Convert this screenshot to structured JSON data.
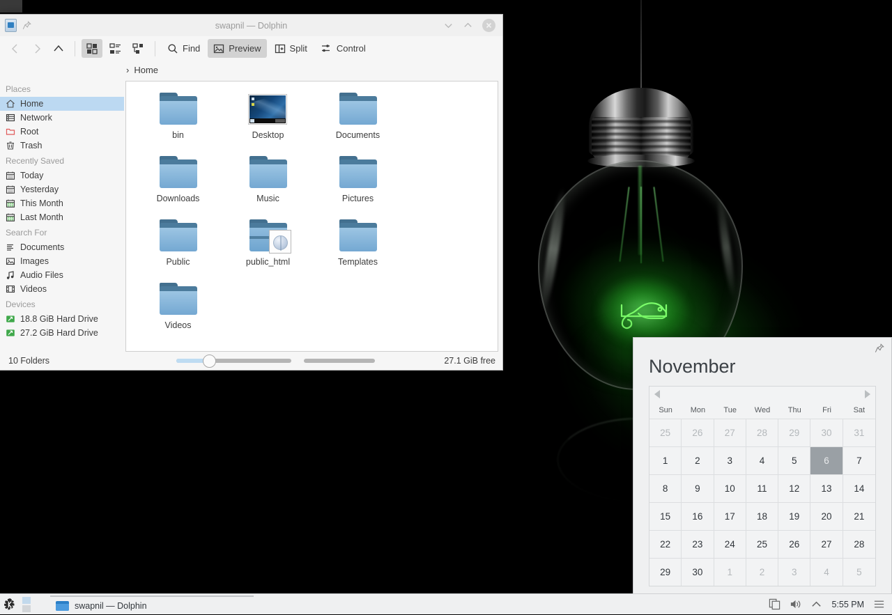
{
  "window": {
    "title": "swapnil — Dolphin",
    "app_icon": "dolphin-icon",
    "pin_icon": "pin-icon",
    "buttons": {
      "minimize": "minimize-icon",
      "maximize": "maximize-icon",
      "close": "close-icon"
    }
  },
  "toolbar": {
    "back": "back-arrow-icon",
    "forward": "forward-arrow-icon",
    "up": "up-arrow-icon",
    "view_icons": "view-icons-icon",
    "view_compact": "view-compact-icon",
    "view_details": "view-details-icon",
    "find_label": "Find",
    "preview_label": "Preview",
    "split_label": "Split",
    "control_label": "Control"
  },
  "breadcrumb": {
    "separator": "›",
    "current": "Home"
  },
  "sidebar": {
    "groups": [
      {
        "title": "Places",
        "items": [
          {
            "label": "Home",
            "icon": "home-icon",
            "selected": true
          },
          {
            "label": "Network",
            "icon": "network-icon",
            "selected": false
          },
          {
            "label": "Root",
            "icon": "root-folder-icon",
            "selected": false
          },
          {
            "label": "Trash",
            "icon": "trash-icon",
            "selected": false
          }
        ]
      },
      {
        "title": "Recently Saved",
        "items": [
          {
            "label": "Today",
            "icon": "calendar-icon",
            "selected": false
          },
          {
            "label": "Yesterday",
            "icon": "calendar-icon",
            "selected": false
          },
          {
            "label": "This Month",
            "icon": "calendar-green-icon",
            "selected": false
          },
          {
            "label": "Last Month",
            "icon": "calendar-green-icon",
            "selected": false
          }
        ]
      },
      {
        "title": "Search For",
        "items": [
          {
            "label": "Documents",
            "icon": "document-icon",
            "selected": false
          },
          {
            "label": "Images",
            "icon": "image-icon",
            "selected": false
          },
          {
            "label": "Audio Files",
            "icon": "audio-icon",
            "selected": false
          },
          {
            "label": "Videos",
            "icon": "video-icon",
            "selected": false
          }
        ]
      },
      {
        "title": "Devices",
        "items": [
          {
            "label": "18.8 GiB Hard Drive",
            "icon": "harddrive-icon",
            "selected": false
          },
          {
            "label": "27.2 GiB Hard Drive",
            "icon": "harddrive-icon",
            "selected": false
          }
        ]
      }
    ]
  },
  "files": [
    {
      "name": "bin",
      "kind": "folder"
    },
    {
      "name": "Desktop",
      "kind": "thumbnail"
    },
    {
      "name": "Documents",
      "kind": "folder"
    },
    {
      "name": "Downloads",
      "kind": "folder"
    },
    {
      "name": "Music",
      "kind": "folder"
    },
    {
      "name": "Pictures",
      "kind": "folder"
    },
    {
      "name": "Public",
      "kind": "folder"
    },
    {
      "name": "public_html",
      "kind": "folder-open-web"
    },
    {
      "name": "Templates",
      "kind": "folder"
    },
    {
      "name": "Videos",
      "kind": "folder"
    }
  ],
  "statusbar": {
    "count": "10 Folders",
    "free_space": "27.1 GiB free"
  },
  "calendar": {
    "month": "November",
    "pin_icon": "pin-icon",
    "prev_icon": "previous-month-icon",
    "next_icon": "next-month-icon",
    "weekdays": [
      "Sun",
      "Mon",
      "Tue",
      "Wed",
      "Thu",
      "Fri",
      "Sat"
    ],
    "today": 6,
    "weeks": [
      [
        {
          "d": "25",
          "other": true
        },
        {
          "d": "26",
          "other": true
        },
        {
          "d": "27",
          "other": true
        },
        {
          "d": "28",
          "other": true
        },
        {
          "d": "29",
          "other": true
        },
        {
          "d": "30",
          "other": true
        },
        {
          "d": "31",
          "other": true
        }
      ],
      [
        {
          "d": "1",
          "other": false
        },
        {
          "d": "2",
          "other": false
        },
        {
          "d": "3",
          "other": false
        },
        {
          "d": "4",
          "other": false
        },
        {
          "d": "5",
          "other": false
        },
        {
          "d": "6",
          "other": false,
          "today": true
        },
        {
          "d": "7",
          "other": false
        }
      ],
      [
        {
          "d": "8",
          "other": false
        },
        {
          "d": "9",
          "other": false
        },
        {
          "d": "10",
          "other": false
        },
        {
          "d": "11",
          "other": false
        },
        {
          "d": "12",
          "other": false
        },
        {
          "d": "13",
          "other": false
        },
        {
          "d": "14",
          "other": false
        }
      ],
      [
        {
          "d": "15",
          "other": false
        },
        {
          "d": "16",
          "other": false
        },
        {
          "d": "17",
          "other": false
        },
        {
          "d": "18",
          "other": false
        },
        {
          "d": "19",
          "other": false
        },
        {
          "d": "20",
          "other": false
        },
        {
          "d": "21",
          "other": false
        }
      ],
      [
        {
          "d": "22",
          "other": false
        },
        {
          "d": "23",
          "other": false
        },
        {
          "d": "24",
          "other": false
        },
        {
          "d": "25",
          "other": false
        },
        {
          "d": "26",
          "other": false
        },
        {
          "d": "27",
          "other": false
        },
        {
          "d": "28",
          "other": false
        }
      ],
      [
        {
          "d": "29",
          "other": false
        },
        {
          "d": "30",
          "other": false
        },
        {
          "d": "1",
          "other": true
        },
        {
          "d": "2",
          "other": true
        },
        {
          "d": "3",
          "other": true
        },
        {
          "d": "4",
          "other": true
        },
        {
          "d": "5",
          "other": true
        }
      ]
    ]
  },
  "panel": {
    "launcher_icon": "kde-launcher-icon",
    "task": {
      "label": "swapnil — Dolphin",
      "icon": "folder-icon"
    },
    "tray": {
      "clipboard_icon": "clipboard-icon",
      "volume_icon": "volume-icon",
      "expand_icon": "chevron-up-icon",
      "clock": "5:55 PM",
      "menu_icon": "hamburger-menu-icon"
    }
  },
  "wallpaper": {
    "theme": "opensuse-lightbulb-chameleon",
    "accent": "#3ecf3e"
  }
}
